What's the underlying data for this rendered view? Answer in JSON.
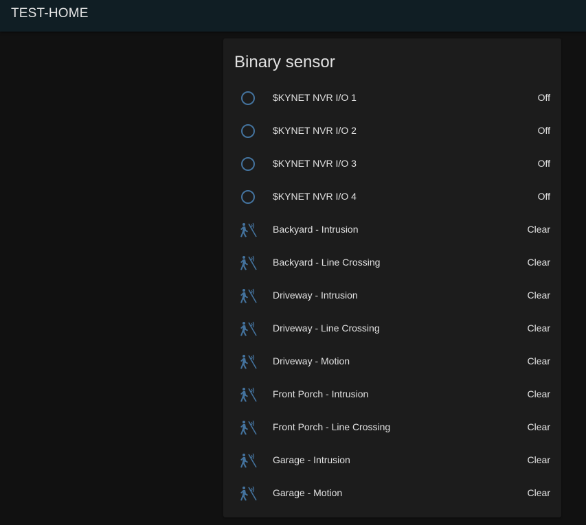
{
  "app": {
    "title": "TEST-HOME"
  },
  "card": {
    "title": "Binary sensor",
    "rows": [
      {
        "icon": "radiobox-blank-icon",
        "label": "$KYNET NVR I/O 1",
        "state": "Off"
      },
      {
        "icon": "radiobox-blank-icon",
        "label": "$KYNET NVR I/O 2",
        "state": "Off"
      },
      {
        "icon": "radiobox-blank-icon",
        "label": "$KYNET NVR I/O 3",
        "state": "Off"
      },
      {
        "icon": "radiobox-blank-icon",
        "label": "$KYNET NVR I/O 4",
        "state": "Off"
      },
      {
        "icon": "motion-sensor-icon",
        "label": "Backyard - Intrusion",
        "state": "Clear"
      },
      {
        "icon": "motion-sensor-icon",
        "label": "Backyard - Line Crossing",
        "state": "Clear"
      },
      {
        "icon": "motion-sensor-icon",
        "label": "Driveway - Intrusion",
        "state": "Clear"
      },
      {
        "icon": "motion-sensor-icon",
        "label": "Driveway - Line Crossing",
        "state": "Clear"
      },
      {
        "icon": "motion-sensor-icon",
        "label": "Driveway - Motion",
        "state": "Clear"
      },
      {
        "icon": "motion-sensor-icon",
        "label": "Front Porch - Intrusion",
        "state": "Clear"
      },
      {
        "icon": "motion-sensor-icon",
        "label": "Front Porch - Line Crossing",
        "state": "Clear"
      },
      {
        "icon": "motion-sensor-icon",
        "label": "Garage - Intrusion",
        "state": "Clear"
      },
      {
        "icon": "motion-sensor-icon",
        "label": "Garage - Motion",
        "state": "Clear"
      }
    ]
  },
  "colors": {
    "background": "#111111",
    "topbar": "#101e24",
    "card": "#1c1c1c",
    "icon": "#44739e",
    "text": "#e1e1e1"
  }
}
